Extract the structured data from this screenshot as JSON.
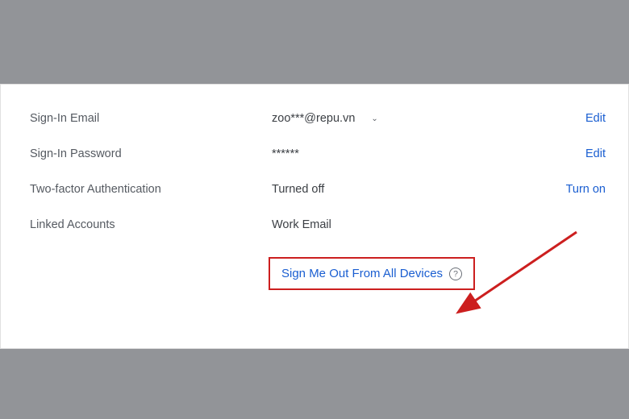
{
  "settings": {
    "signin_email": {
      "label": "Sign-In Email",
      "value": "zoo***@repu.vn",
      "action": "Edit"
    },
    "signin_password": {
      "label": "Sign-In Password",
      "value": "******",
      "action": "Edit"
    },
    "two_factor": {
      "label": "Two-factor Authentication",
      "value": "Turned off",
      "action": "Turn on"
    },
    "linked_accounts": {
      "label": "Linked Accounts",
      "value": "Work Email"
    },
    "signout": {
      "label": "Sign Me Out From All Devices",
      "help_icon": "?"
    }
  },
  "colors": {
    "link": "#1a5ed1",
    "highlight_border": "#cc1f1f",
    "text_muted": "#555a61",
    "text_body": "#3b3f44"
  }
}
